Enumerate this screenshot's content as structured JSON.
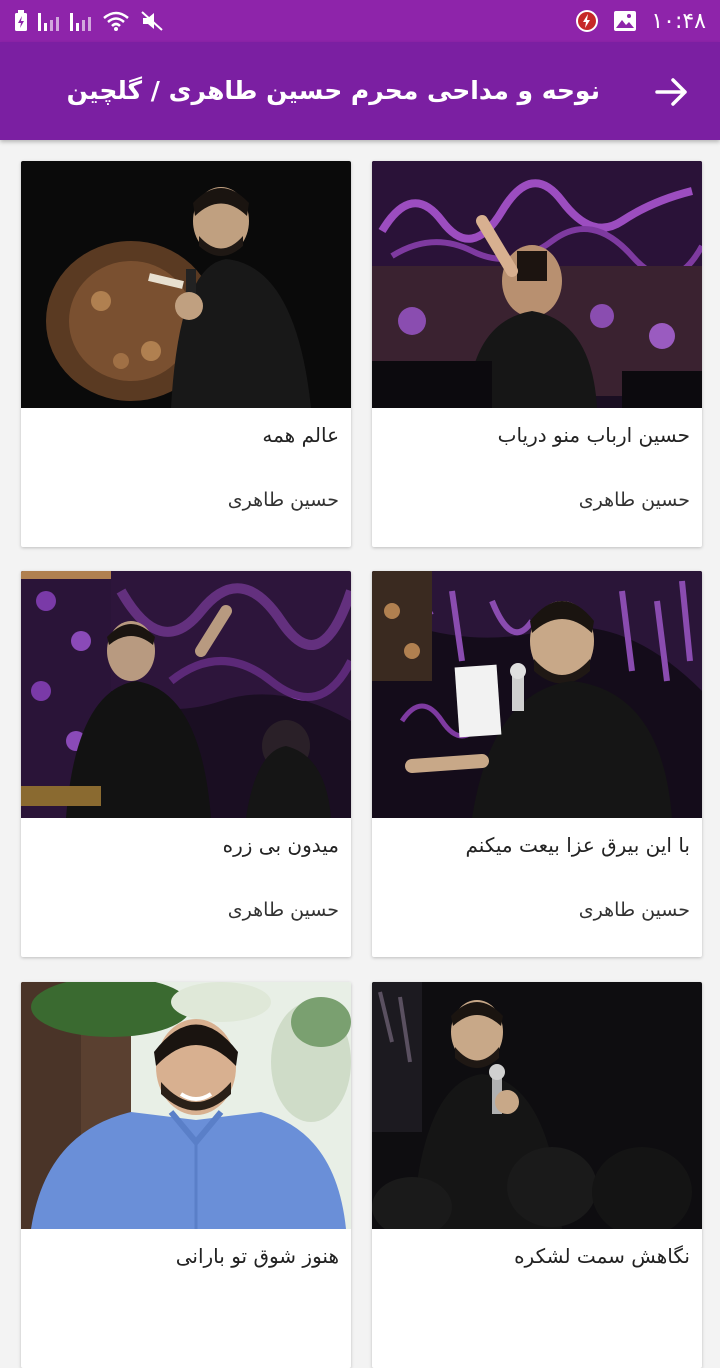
{
  "status_bar": {
    "time": "۱۰:۴۸",
    "icons": [
      "battery-charging-icon",
      "signal-icon",
      "signal-icon",
      "wifi-icon",
      "mute-icon",
      "notification-icon",
      "gallery-icon"
    ]
  },
  "header": {
    "title": "نوحه و مداحی محرم حسین طاهری / گلچین",
    "back_icon": "arrow-right-icon"
  },
  "colors": {
    "status_bar": "#8e24aa",
    "app_bar": "#7b1fa2",
    "accent_purple": "#9c27b0"
  },
  "cards": [
    {
      "title": "حسین ارباب منو دریاب",
      "artist": "حسین طاهری"
    },
    {
      "title": "عالم همه",
      "artist": "حسین طاهری"
    },
    {
      "title": "با این بیرق عزا بیعت میکنم",
      "artist": "حسین طاهری"
    },
    {
      "title": "میدون بی زره",
      "artist": "حسین طاهری"
    },
    {
      "title": "نگاهش سمت لشکره",
      "artist": ""
    },
    {
      "title": "هنوز شوق تو بارانی",
      "artist": ""
    }
  ]
}
